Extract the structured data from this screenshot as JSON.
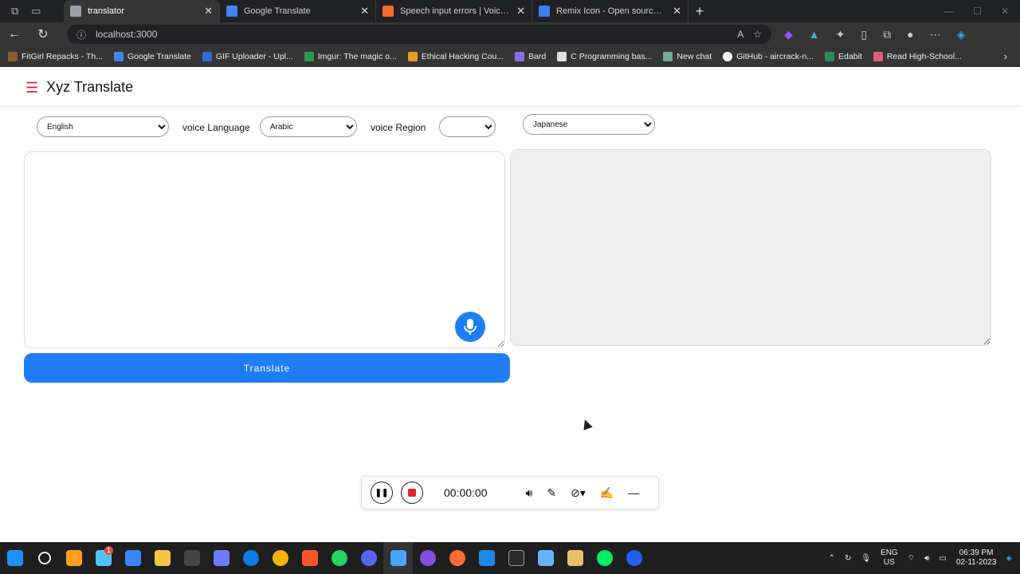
{
  "browser": {
    "tabs": [
      {
        "title": "translator",
        "favicon_color": "#9aa0a6",
        "active": true
      },
      {
        "title": "Google Translate",
        "favicon_color": "#4285f4",
        "active": false
      },
      {
        "title": "Speech input errors | Voice notel",
        "favicon_color": "#f06a2a",
        "active": false
      },
      {
        "title": "Remix Icon - Open source icon li",
        "favicon_color": "#3b7ff2",
        "active": false
      }
    ],
    "address": "localhost:3000",
    "bookmarks": [
      {
        "label": "FitGirl Repacks - Th...",
        "color": "#8b5a2b"
      },
      {
        "label": "Google Translate",
        "color": "#4285f4"
      },
      {
        "label": "GIF Uploader - Upl...",
        "color": "#2f6fd6"
      },
      {
        "label": "Imgur: The magic o...",
        "color": "#2b9b4b"
      },
      {
        "label": "Ethical Hacking Cou...",
        "color": "#e0a020"
      },
      {
        "label": "Bard",
        "color": "#8a6cf0"
      },
      {
        "label": "C Programming bas...",
        "color": "#dddddd"
      },
      {
        "label": "New chat",
        "color": "#74aa9c"
      },
      {
        "label": "GitHub - aircrack-n...",
        "color": "#ffffff"
      },
      {
        "label": "Edabit",
        "color": "#2e8b57"
      },
      {
        "label": "Read High-School...",
        "color": "#e25b7a"
      }
    ]
  },
  "app": {
    "title": "Xyz Translate",
    "from_language": "English",
    "voice_language_label": "voice Language",
    "voice_language": "Arabic",
    "voice_region_label": "voice Region",
    "voice_region": "",
    "to_language": "Japanese",
    "source_text": "",
    "translated_text": "",
    "translate_button": "Translate"
  },
  "recorder": {
    "time": "00:00:00"
  },
  "taskbar": {
    "apps": [
      "#1e90ff",
      "#f3f3f3",
      "#ff9f1c",
      "#4fc3f7",
      "#3a86ff",
      "#f5c542",
      "#cccccc",
      "#6b7cff",
      "#0f7be8",
      "#f4b400",
      "#fb542b",
      "#25d366",
      "#5865f2",
      "#4aa3ff",
      "#8250df",
      "#ff6b35",
      "#1e88e5",
      "#2b2b2b",
      "#66b2ff",
      "#e8c26a",
      "#00ed64",
      "#1d63ed"
    ],
    "lang_top": "ENG",
    "lang_bottom": "US",
    "time": "06:39 PM",
    "date": "02-11-2023",
    "badge_count": "1"
  }
}
